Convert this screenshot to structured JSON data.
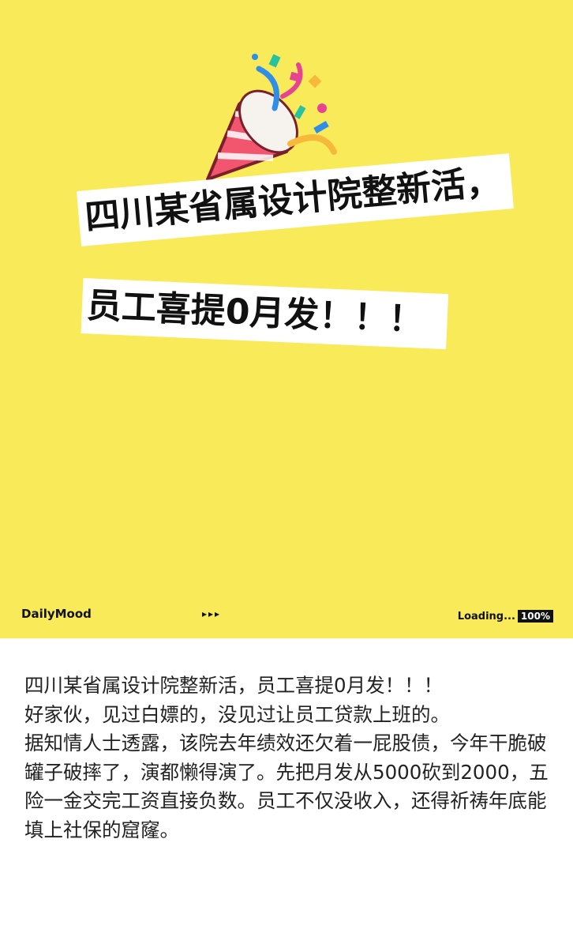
{
  "cover": {
    "background": "#f9ea5a",
    "illustration": "party-popper-icon",
    "headline_line1": "四川某省属设计院整新活，",
    "headline_line2": "员工喜提0月发！！！",
    "brand": "DailyMood",
    "dots": "▸▸▸",
    "loading_label": "Loading...",
    "loading_percent": "100%"
  },
  "article": {
    "paragraphs": [
      "四川某省属设计院整新活，员工喜提0月发！！！",
      "好家伙，见过白嫖的，没见过让员工贷款上班的。",
      "据知情人士透露，该院去年绩效还欠着一屁股债，今年干脆破罐子破摔了，演都懒得演了。先把月发从5000砍到2000，五险一金交完工资直接负数。员工不仅没收入，还得祈祷年底能填上社保的窟窿。"
    ]
  }
}
